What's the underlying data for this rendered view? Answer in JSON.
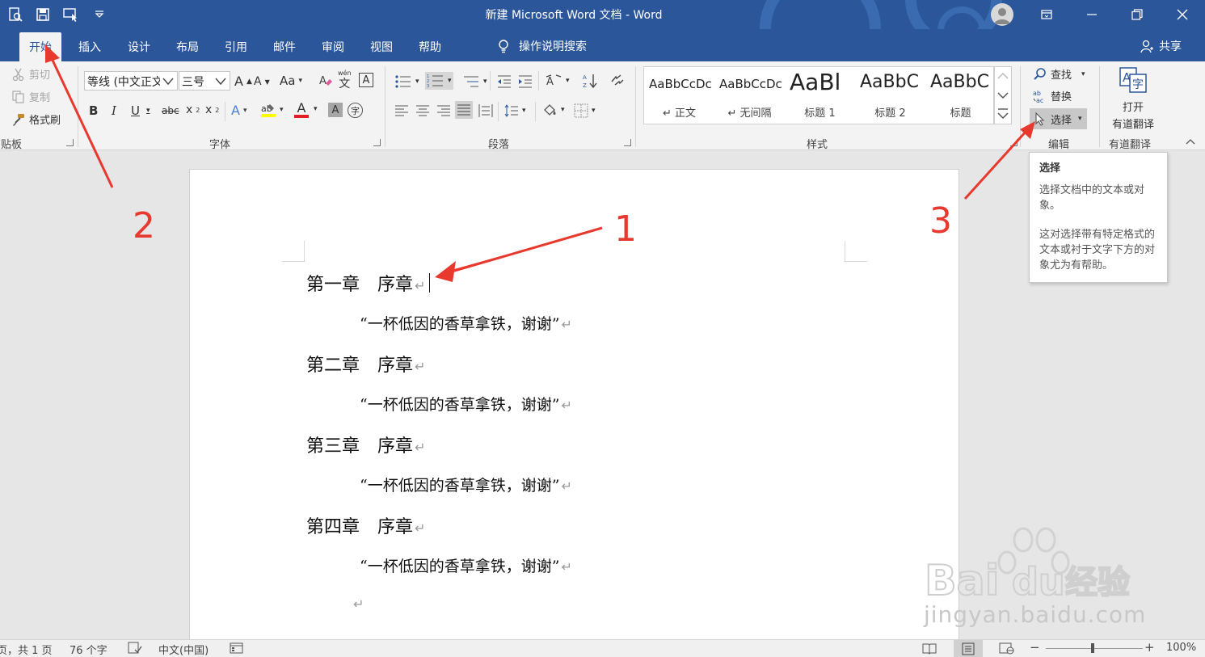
{
  "titlebar": {
    "title": "新建 Microsoft Word 文档  -  Word",
    "colors": {
      "brand": "#2b579a",
      "accent_red": "#e8392f"
    }
  },
  "tabs": [
    {
      "label": "开始",
      "active": true
    },
    {
      "label": "插入"
    },
    {
      "label": "设计"
    },
    {
      "label": "布局"
    },
    {
      "label": "引用"
    },
    {
      "label": "邮件"
    },
    {
      "label": "审阅"
    },
    {
      "label": "视图"
    },
    {
      "label": "帮助"
    }
  ],
  "tellme": {
    "label": "操作说明搜索",
    "icon": "lightbulb-icon"
  },
  "share": {
    "label": "共享",
    "icon": "person-icon"
  },
  "clipboard": {
    "cut": "剪切",
    "copy": "复制",
    "format_painter": "格式刷",
    "group_label": "剪贴板"
  },
  "font": {
    "family": "等线 (中文正文)",
    "size": "三号",
    "case_label": "Aa",
    "phonetic_top": "wén",
    "phonetic_char": "文",
    "border_char": "A",
    "bold": "B",
    "italic": "I",
    "underline": "U",
    "strike": "abc",
    "sub": "x",
    "sub_mark": "2",
    "sup": "x",
    "sup_mark": "2",
    "effects": "A",
    "color": "A",
    "shade": "A",
    "enclose": "字",
    "group_label": "字体"
  },
  "paragraph": {
    "group_label": "段落"
  },
  "styles": {
    "items": [
      {
        "preview": "AaBbCcDc",
        "name": "↵ 正文"
      },
      {
        "preview": "AaBbCcDc",
        "name": "↵ 无间隔"
      },
      {
        "preview": "AaBl",
        "name": "标题 1"
      },
      {
        "preview": "AaBbC",
        "name": "标题 2"
      },
      {
        "preview": "AaBbC",
        "name": "标题"
      }
    ],
    "group_label": "样式"
  },
  "editing": {
    "find": "查找",
    "replace": "替换",
    "select": "选择",
    "group_label": "编辑"
  },
  "youdao": {
    "line1": "打开",
    "line2": "有道翻译",
    "group_label": "有道翻译"
  },
  "tooltip": {
    "title": "选择",
    "text1": "选择文档中的文本或对象。",
    "text2": "这对选择带有特定格式的文本或衬于文字下方的对象尤为有帮助。"
  },
  "document": {
    "lines": [
      {
        "kind": "h",
        "text": "第一章　序章"
      },
      {
        "kind": "p",
        "text": "“一杯低因的香草拿铁，谢谢”"
      },
      {
        "kind": "h",
        "text": "第二章　序章"
      },
      {
        "kind": "p",
        "text": "“一杯低因的香草拿铁，谢谢”"
      },
      {
        "kind": "h",
        "text": "第三章　序章"
      },
      {
        "kind": "p",
        "text": "“一杯低因的香草拿铁，谢谢”"
      },
      {
        "kind": "h",
        "text": "第四章　序章"
      },
      {
        "kind": "p",
        "text": "“一杯低因的香草拿铁，谢谢”"
      }
    ],
    "paragraph_mark": "↵"
  },
  "status": {
    "page": "页，共 1 页",
    "words": "76 个字",
    "language": "中文(中国)",
    "zoom": "100%",
    "zoom_minus": "−",
    "zoom_plus": "+"
  },
  "annotations": {
    "n1": "1",
    "n2": "2",
    "n3": "3"
  },
  "watermark": {
    "domain": "jingyan.baidu.com"
  }
}
